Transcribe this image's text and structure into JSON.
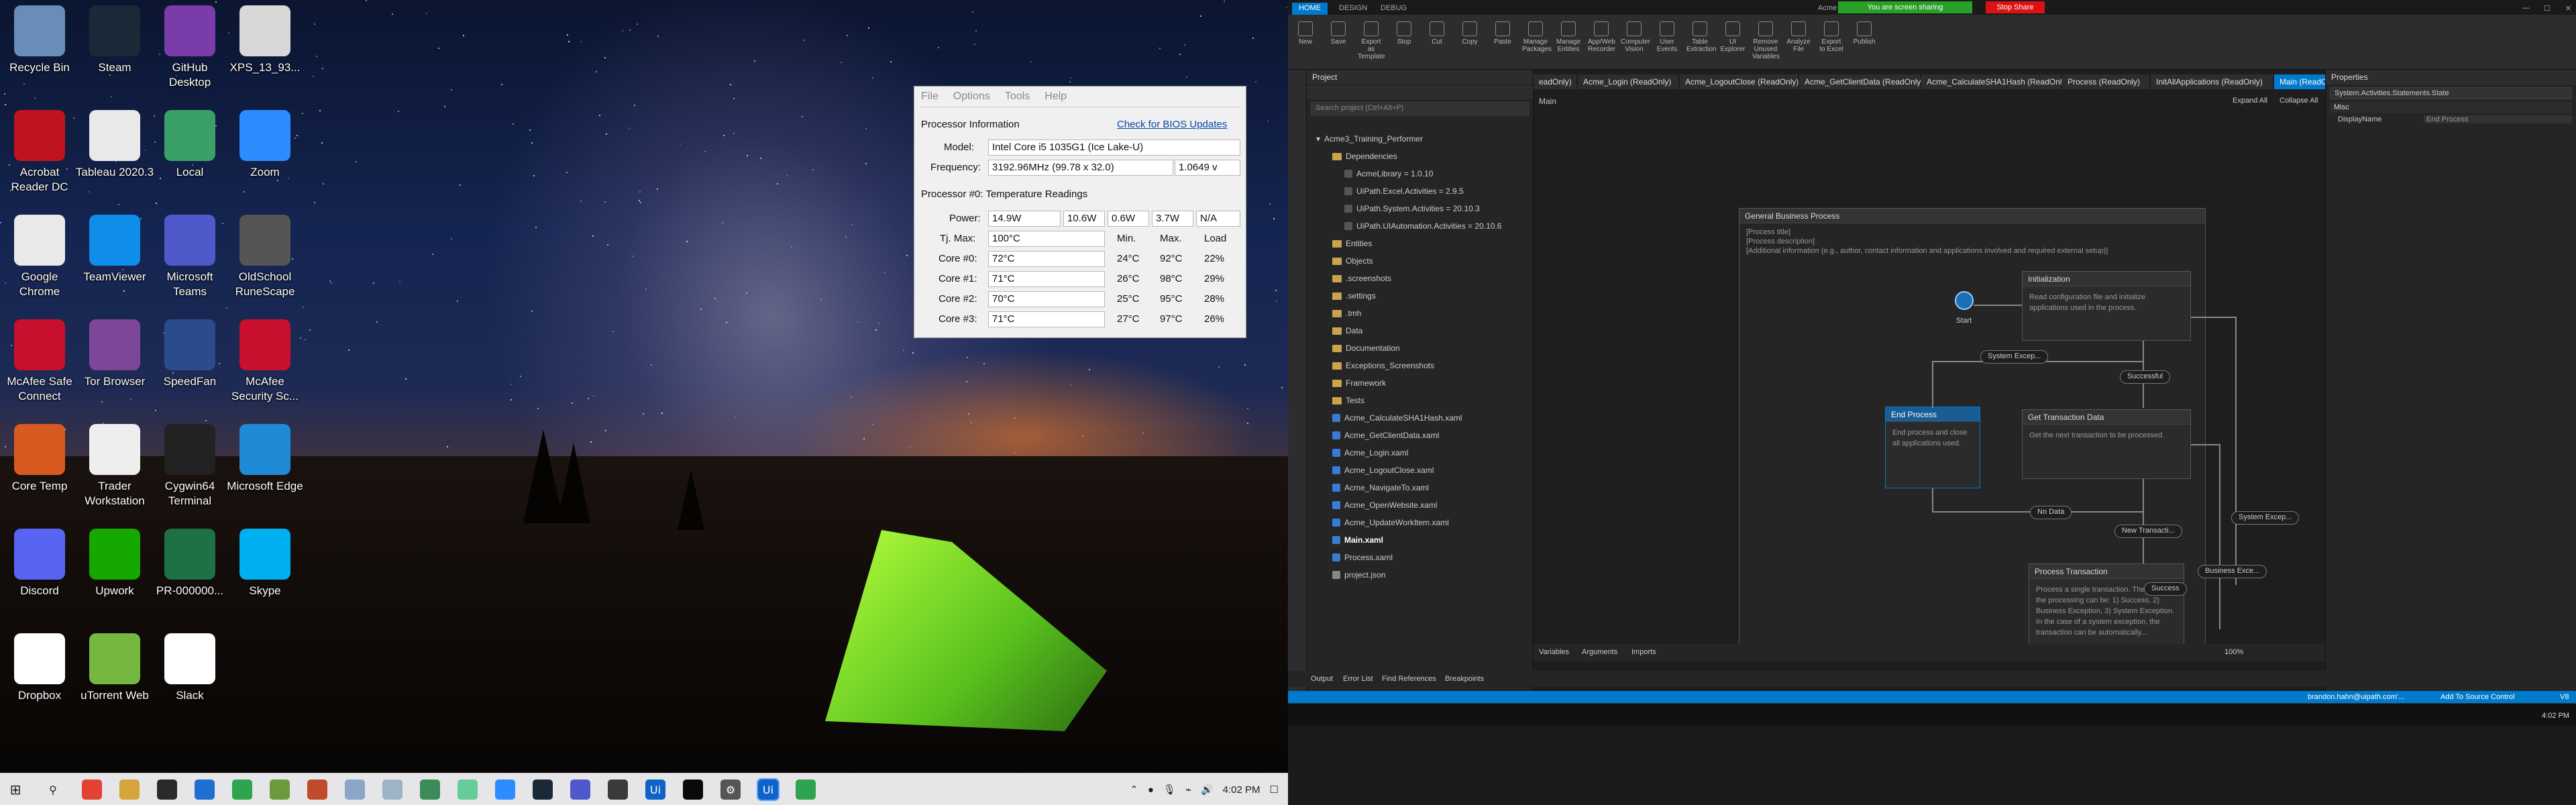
{
  "desktop": {
    "icons": [
      {
        "label": "Recycle Bin",
        "icon": "recycle-bin-icon",
        "color": "#6a8db7"
      },
      {
        "label": "Steam",
        "icon": "steam-icon",
        "color": "#1b2838"
      },
      {
        "label": "GitHub Desktop",
        "icon": "github-desktop-icon",
        "color": "#7a3ca8"
      },
      {
        "label": "XPS_13_93...",
        "icon": "document-icon",
        "color": "#d8d8d8"
      },
      {
        "label": "Acrobat Reader DC",
        "icon": "acrobat-icon",
        "color": "#c1121f"
      },
      {
        "label": "Tableau 2020.3",
        "icon": "tableau-icon",
        "color": "#e9e9e9"
      },
      {
        "label": "Local",
        "icon": "local-icon",
        "color": "#3aa067"
      },
      {
        "label": "Zoom",
        "icon": "zoom-icon",
        "color": "#2d8cff"
      },
      {
        "label": "Google Chrome",
        "icon": "chrome-icon",
        "color": "#e9e9e9"
      },
      {
        "label": "TeamViewer",
        "icon": "teamviewer-icon",
        "color": "#0e8ee9"
      },
      {
        "label": "Microsoft Teams",
        "icon": "teams-icon",
        "color": "#5059c9"
      },
      {
        "label": "OldSchool RuneScape",
        "icon": "runescape-icon",
        "color": "#555"
      },
      {
        "label": "McAfee Safe Connect",
        "icon": "mcafee-safe-connect-icon",
        "color": "#c8102e"
      },
      {
        "label": "Tor Browser",
        "icon": "tor-browser-icon",
        "color": "#7d4698"
      },
      {
        "label": "SpeedFan",
        "icon": "speedfan-icon",
        "color": "#2b4c8c"
      },
      {
        "label": "McAfee Security Sc...",
        "icon": "mcafee-icon",
        "color": "#c8102e"
      },
      {
        "label": "Core Temp",
        "icon": "core-temp-icon",
        "color": "#d85a20"
      },
      {
        "label": "Trader Workstation",
        "icon": "trader-workstation-icon",
        "color": "#eee"
      },
      {
        "label": "Cygwin64 Terminal",
        "icon": "cygwin-icon",
        "color": "#222"
      },
      {
        "label": "Microsoft Edge",
        "icon": "edge-icon",
        "color": "#1f8bd6"
      },
      {
        "label": "Discord",
        "icon": "discord-icon",
        "color": "#5865f2"
      },
      {
        "label": "Upwork",
        "icon": "upwork-icon",
        "color": "#14a800"
      },
      {
        "label": "PR-000000...",
        "icon": "excel-icon",
        "color": "#1e7145"
      },
      {
        "label": "Skype",
        "icon": "skype-icon",
        "color": "#00aff0"
      },
      {
        "label": "Dropbox",
        "icon": "dropbox-icon",
        "color": "#fff"
      },
      {
        "label": "uTorrent Web",
        "icon": "utorrent-icon",
        "color": "#76b83f"
      },
      {
        "label": "Slack",
        "icon": "slack-icon",
        "color": "#fff"
      }
    ]
  },
  "taskbar": {
    "time": "4:02 PM"
  },
  "coretemp": {
    "menu": [
      "File",
      "Options",
      "Tools",
      "Help"
    ],
    "proc_info_label": "Processor Information",
    "bios_link": "Check for BIOS Updates",
    "model_label": "Model:",
    "model_value": "Intel Core i5 1035G1 (Ice Lake-U)",
    "freq_label": "Frequency:",
    "freq_value": "3192.96MHz (99.78 x 32.0)",
    "volt_value": "1.0649 v",
    "temp_header": "Processor #0: Temperature Readings",
    "power_label": "Power:",
    "power_values": [
      "14.9W",
      "10.6W",
      "0.6W",
      "3.7W",
      "N/A"
    ],
    "tjmax_label": "Tj. Max:",
    "tjmax_value": "100°C",
    "col_min": "Min.",
    "col_max": "Max.",
    "col_load": "Load",
    "cores": [
      {
        "name": "Core #0:",
        "temp": "72°C",
        "min": "24°C",
        "max": "92°C",
        "load": "22%"
      },
      {
        "name": "Core #1:",
        "temp": "71°C",
        "min": "26°C",
        "max": "98°C",
        "load": "29%"
      },
      {
        "name": "Core #2:",
        "temp": "70°C",
        "min": "25°C",
        "max": "95°C",
        "load": "28%"
      },
      {
        "name": "Core #3:",
        "temp": "71°C",
        "min": "27°C",
        "max": "97°C",
        "load": "26%"
      }
    ]
  },
  "studio": {
    "ribbon_tabs": [
      "HOME",
      "DESIGN",
      "DEBUG"
    ],
    "app_title_fragment": "Acme",
    "sharing_text": "You are screen sharing",
    "stop_share": "Stop Share",
    "ribbon_buttons": [
      "New",
      "Save",
      "Export as Template",
      "Stop",
      "Cut",
      "Copy",
      "Paste",
      "Manage Packages",
      "Manage Entities",
      "App/Web Recorder",
      "Computer Vision",
      "User Events",
      "Table Extraction",
      "UI Explorer",
      "Remove Unused Variables",
      "Analyze File",
      "Export to Excel",
      "Publish"
    ],
    "project_title": "Project",
    "search_placeholder": "Search project (Ctrl+Alt+P)",
    "project_root": "Acme3_Training_Performer",
    "tree": [
      {
        "label": "Dependencies",
        "type": "folder",
        "level": 1
      },
      {
        "label": "AcmeLibrary = 1.0.10",
        "type": "dep",
        "level": 2
      },
      {
        "label": "UiPath.Excel.Activities = 2.9.5",
        "type": "dep",
        "level": 2
      },
      {
        "label": "UiPath.System.Activities = 20.10.3",
        "type": "dep",
        "level": 2
      },
      {
        "label": "UiPath.UIAutomation.Activities = 20.10.6",
        "type": "dep",
        "level": 2
      },
      {
        "label": "Entities",
        "type": "folder",
        "level": 1
      },
      {
        "label": "Objects",
        "type": "folder",
        "level": 1
      },
      {
        "label": ".screenshots",
        "type": "folder",
        "level": 1
      },
      {
        "label": ".settings",
        "type": "folder",
        "level": 1
      },
      {
        "label": ".tmh",
        "type": "folder",
        "level": 1
      },
      {
        "label": "Data",
        "type": "folder",
        "level": 1
      },
      {
        "label": "Documentation",
        "type": "folder",
        "level": 1
      },
      {
        "label": "Exceptions_Screenshots",
        "type": "folder",
        "level": 1
      },
      {
        "label": "Framework",
        "type": "folder",
        "level": 1
      },
      {
        "label": "Tests",
        "type": "folder",
        "level": 1
      },
      {
        "label": "Acme_CalculateSHA1Hash.xaml",
        "type": "file",
        "level": 1
      },
      {
        "label": "Acme_GetClientData.xaml",
        "type": "file",
        "level": 1
      },
      {
        "label": "Acme_Login.xaml",
        "type": "file",
        "level": 1
      },
      {
        "label": "Acme_LogoutClose.xaml",
        "type": "file",
        "level": 1
      },
      {
        "label": "Acme_NavigateTo.xaml",
        "type": "file",
        "level": 1
      },
      {
        "label": "Acme_OpenWebsite.xaml",
        "type": "file",
        "level": 1
      },
      {
        "label": "Acme_UpdateWorkItem.xaml",
        "type": "file",
        "level": 1
      },
      {
        "label": "Main.xaml",
        "type": "file",
        "level": 1
      },
      {
        "label": "Process.xaml",
        "type": "file",
        "level": 1
      },
      {
        "label": "project.json",
        "type": "json",
        "level": 1
      }
    ],
    "doc_tabs": [
      "eadOnly)",
      "Acme_Login (ReadOnly)",
      "Acme_LogoutClose (ReadOnly)",
      "Acme_GetClientData (ReadOnly)",
      "Acme_CalculateSHA1Hash (ReadOnly)",
      "Process (ReadOnly)",
      "InitAllApplications (ReadOnly)",
      "Main (ReadOnly)"
    ],
    "breadcrumb": "Main",
    "expand_all": "Expand All",
    "collapse_all": "Collapse All",
    "flow_title": "General Business Process",
    "flow_desc": [
      "[Process title]",
      "[Process description]",
      "[Additional information (e.g., author, contact information and applications involved and required external setup)]"
    ],
    "start_label": "Start",
    "init_title": "Initialization",
    "init_desc": "Read configuration file and initialize applications used in the process.",
    "end_title": "End Process",
    "end_desc": "End process and close all applications used.",
    "get_title": "Get Transaction Data",
    "get_desc": "Get the next transaction to be processed.",
    "proc_title": "Process Transaction",
    "proc_desc": "Process a single transaction. The result of the processing can be: 1) Success, 2) Business Exception, 3) System Exception. In the case of a system exception, the transaction can be automatically...",
    "pills": {
      "sys_exc": "System Excep...",
      "successful": "Successful",
      "no_data": "No Data",
      "new_trans": "New Transacti...",
      "sys_exc2": "System Excep...",
      "bus_exc": "Business Exce...",
      "success": "Success"
    },
    "designer_tabs": [
      "Variables",
      "Arguments",
      "Imports"
    ],
    "zoom": "100%",
    "output_tabs": [
      "Output",
      "Error List",
      "Find References",
      "Breakpoints"
    ],
    "props_title": "Properties",
    "props_type": "System.Activities.Statements.State",
    "props_section": "Misc",
    "props_row_label": "DisplayName",
    "props_row_value": "End Process",
    "status_user": "brandon.hahn@uipath.com'...",
    "status_source": "Add To Source Control",
    "status_v": "V8",
    "right_time": "4:02 PM"
  }
}
